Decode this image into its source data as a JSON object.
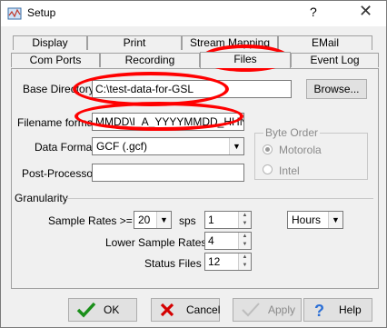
{
  "window": {
    "title": "Setup",
    "help_symbol": "?",
    "close_symbol": "✕"
  },
  "tabs": {
    "row1": [
      "Display",
      "Print",
      "Stream Mapping",
      "EMail"
    ],
    "row2": [
      "Com Ports",
      "Recording",
      "Files",
      "Event Log"
    ],
    "active": "Files"
  },
  "files": {
    "base_directory_label": "Base Directory",
    "base_directory_value": "C:\\test-data-for-GSL",
    "browse_label": "Browse...",
    "filename_format_label": "Filename format",
    "filename_format_value": "MMDD\\I_A_YYYYMMDD_HHNN",
    "data_format_label": "Data Format",
    "data_format_value": "GCF (.gcf)",
    "post_processor_label": "Post-Processor",
    "post_processor_value": "",
    "byte_order": {
      "title": "Byte Order",
      "options": [
        "Motorola",
        "Intel"
      ],
      "selected": "Motorola"
    }
  },
  "granularity": {
    "title": "Granularity",
    "sample_rates_label": "Sample Rates >=",
    "sample_rates_value": "20",
    "sps_label": "sps",
    "sps_value": "1",
    "unit_value": "Hours",
    "lower_label": "Lower Sample Rates",
    "lower_value": "4",
    "status_label": "Status Files",
    "status_value": "12"
  },
  "buttons": {
    "ok": "OK",
    "cancel": "Cancel",
    "apply": "Apply",
    "help": "Help"
  },
  "colors": {
    "ok_check": "#1a8f1a",
    "cancel_x": "#d40000",
    "annotation": "#ff0000",
    "help_icon": "#2b6fd6"
  }
}
